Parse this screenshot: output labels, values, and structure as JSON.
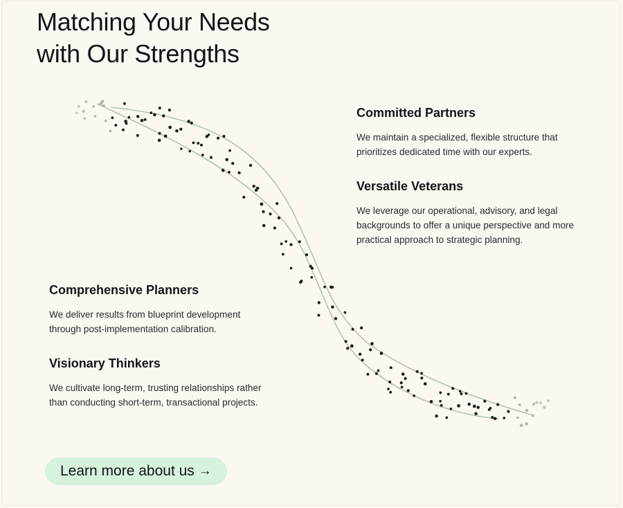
{
  "heading": {
    "line1": "Matching Your Needs",
    "line2": "with Our Strengths"
  },
  "features": {
    "committed": {
      "title": "Committed Partners",
      "body": "We maintain a specialized, flexible structure that prioritizes dedicated time with our experts."
    },
    "versatile": {
      "title": "Versatile Veterans",
      "body": "We leverage our operational, advisory, and legal backgrounds to offer a unique perspective and more practical approach to strategic planning."
    },
    "comprehensive": {
      "title": "Comprehensive Planners",
      "body": "We deliver results from blueprint development through post-implementation calibration."
    },
    "visionary": {
      "title": "Visionary Thinkers",
      "body": "We cultivate long-term, trusting relationships rather than conducting short-term, transactional projects."
    }
  },
  "cta": {
    "label": "Learn more about us",
    "arrow": "→"
  },
  "colors": {
    "background": "#fbf7f1",
    "curve": "#a9c8ae",
    "dot": "#1c1c1c",
    "button": "#d6f2dd"
  }
}
